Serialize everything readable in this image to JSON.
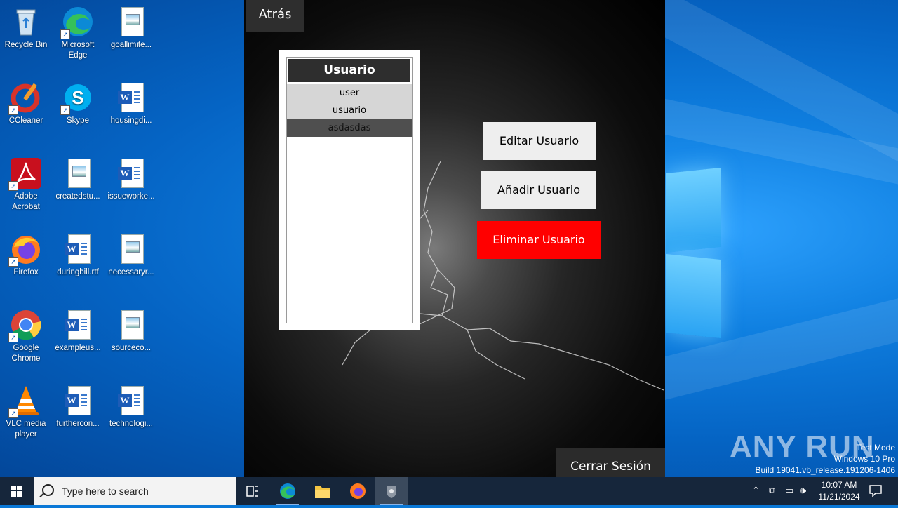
{
  "desktop": {
    "icons": [
      {
        "label": "Recycle Bin",
        "name": "recycle-bin-icon"
      },
      {
        "label": "Microsoft Edge",
        "name": "edge-icon"
      },
      {
        "label": "goallimite...",
        "name": "image-file-icon"
      },
      {
        "label": "CCleaner",
        "name": "ccleaner-icon"
      },
      {
        "label": "Skype",
        "name": "skype-icon"
      },
      {
        "label": "housingdi...",
        "name": "word-file-icon"
      },
      {
        "label": "Adobe Acrobat",
        "name": "acrobat-icon"
      },
      {
        "label": "createdstu...",
        "name": "image-file-icon"
      },
      {
        "label": "issueworke...",
        "name": "word-file-icon"
      },
      {
        "label": "Firefox",
        "name": "firefox-icon"
      },
      {
        "label": "duringbill.rtf",
        "name": "word-file-icon"
      },
      {
        "label": "necessaryr...",
        "name": "image-file-icon"
      },
      {
        "label": "Google Chrome",
        "name": "chrome-icon"
      },
      {
        "label": "exampleus...",
        "name": "word-file-icon"
      },
      {
        "label": "sourceco...",
        "name": "image-file-icon"
      },
      {
        "label": "VLC media player",
        "name": "vlc-icon"
      },
      {
        "label": "furthercon...",
        "name": "word-file-icon"
      },
      {
        "label": "technologi...",
        "name": "word-file-icon"
      }
    ]
  },
  "app": {
    "back_label": "Atrás",
    "list": {
      "header": "Usuario",
      "rows": [
        "user",
        "usuario",
        "asdasdas"
      ],
      "selected_index": 2
    },
    "edit_label": "Editar Usuario",
    "add_label": "Añadir Usuario",
    "delete_label": "Eliminar Usuario",
    "logout_label": "Cerrar Sesión",
    "colors": {
      "delete_bg": "#ff0000",
      "button_bg": "#eeeeee",
      "header_bg": "#2e2e2e"
    }
  },
  "watermark": {
    "brand": "ANY RUN",
    "line1": "Test Mode",
    "line2": "Windows 10 Pro",
    "line3": "Build 19041.vb_release.191206-1406"
  },
  "taskbar": {
    "search_placeholder": "Type here to search",
    "time": "10:07 AM",
    "date": "11/21/2024"
  }
}
